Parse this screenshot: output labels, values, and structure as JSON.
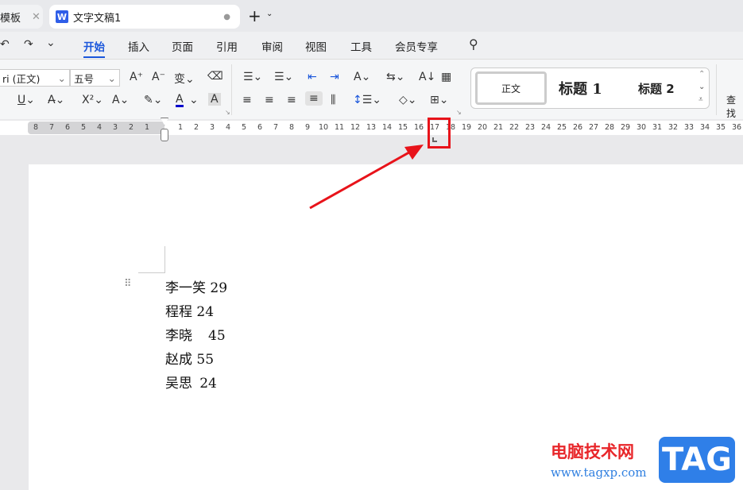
{
  "tabs": [
    {
      "label": "模板"
    },
    {
      "label": "文字文稿1",
      "icon": "wps-writer-icon"
    }
  ],
  "menu": {
    "items": [
      "开始",
      "插入",
      "页面",
      "引用",
      "审阅",
      "视图",
      "工具",
      "会员专享"
    ],
    "active": "开始"
  },
  "ribbon": {
    "font_name": "ri (正文)",
    "font_size": "五号",
    "styles": [
      "正文",
      "标题 1",
      "标题 2"
    ],
    "find_label": "查找"
  },
  "ruler": {
    "left": [
      "8",
      "7",
      "6",
      "5",
      "4",
      "3",
      "2",
      "1"
    ],
    "right": [
      "1",
      "2",
      "3",
      "4",
      "5",
      "6",
      "7",
      "8",
      "9",
      "10",
      "11",
      "12",
      "13",
      "14",
      "15",
      "16",
      "17",
      "18",
      "19",
      "20",
      "21",
      "22",
      "23",
      "24",
      "25",
      "26",
      "27",
      "28",
      "29",
      "30",
      "31",
      "32",
      "33",
      "34",
      "35",
      "36"
    ]
  },
  "document": {
    "lines": [
      "李一笑 29",
      "程程 24",
      "李晓\t45",
      "赵成 55",
      "吴思\t24"
    ]
  },
  "annotation": {
    "highlight_color": "#e8131a"
  },
  "watermark": {
    "site": "电脑技术网",
    "url": "www.tagxp.com",
    "badge": "TAG"
  },
  "colors": {
    "accent": "#1a56db",
    "text_color_bar": "#0000cc"
  }
}
